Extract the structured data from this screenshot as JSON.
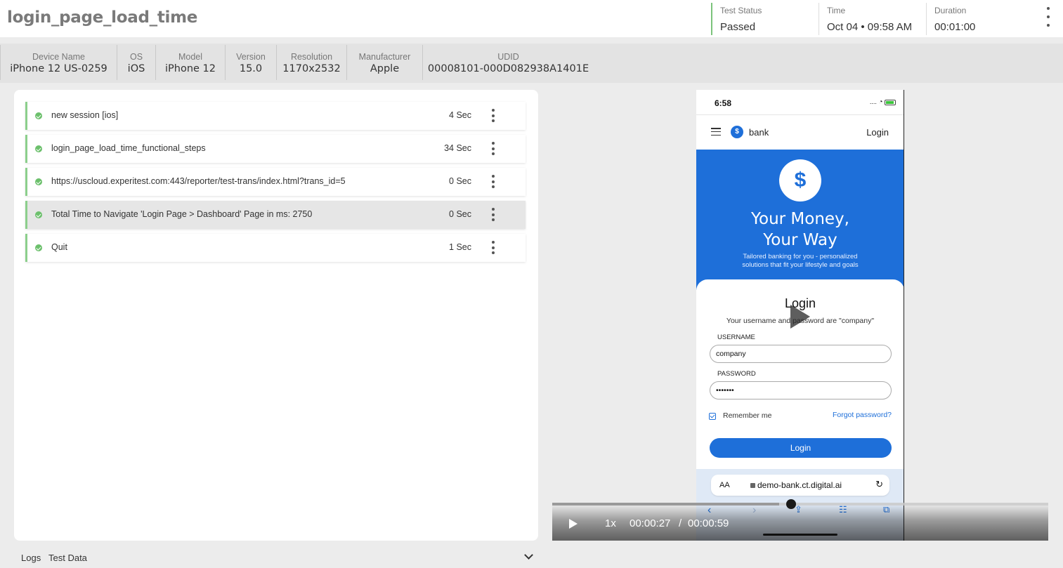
{
  "header": {
    "title": "login_page_load_time",
    "status_label": "Test Status",
    "status_value": "Passed",
    "time_label": "Time",
    "time_value": "Oct 04 • 09:58 AM",
    "duration_label": "Duration",
    "duration_value": "00:01:00"
  },
  "device": {
    "columns": [
      {
        "label": "Device Name",
        "value": "iPhone 12 US-0259"
      },
      {
        "label": "OS",
        "value": "iOS"
      },
      {
        "label": "Model",
        "value": "iPhone 12"
      },
      {
        "label": "Version",
        "value": "15.0"
      },
      {
        "label": "Resolution",
        "value": "1170x2532"
      },
      {
        "label": "Manufacturer",
        "value": "Apple"
      },
      {
        "label": "UDID",
        "value": "00008101-000D082938A1401E"
      }
    ]
  },
  "steps": [
    {
      "name": "new session [ios]",
      "duration": "4 Sec",
      "status": "passed"
    },
    {
      "name": "login_page_load_time_functional_steps",
      "duration": "34 Sec",
      "status": "passed"
    },
    {
      "name": "https://uscloud.experitest.com:443/reporter/test-trans/index.html?trans_id=5",
      "duration": "0 Sec",
      "status": "passed"
    },
    {
      "name": "Total Time to Navigate 'Login Page > Dashboard' Page in ms: 2750",
      "duration": "0 Sec",
      "status": "passed",
      "selected": true
    },
    {
      "name": "Quit",
      "duration": "1 Sec",
      "status": "passed"
    }
  ],
  "phone": {
    "clock": "6:58",
    "signal": "....",
    "app_name": "bank",
    "app_login": "Login",
    "logo_glyph": "$",
    "hero_title_1": "Your Money,",
    "hero_title_2": "Your Way",
    "hero_sub": "Tailored banking for you - personalized solutions that fit your lifestyle and goals",
    "login_title": "Login",
    "login_hint": "Your username and password are \"company\"",
    "username_label": "USERNAME",
    "username_value": "company",
    "password_label": "PASSWORD",
    "password_value": "•••••••",
    "remember_label": "Remember me",
    "forgot_label": "Forgot password?",
    "login_button": "Login",
    "aa": "AA",
    "url": "demo-bank.ct.digital.ai"
  },
  "player": {
    "speed": "1x",
    "current_time": "00:00:27",
    "separator": "/",
    "total_time": "00:00:59",
    "progress": 0.4576
  },
  "footer": {
    "tab_logs": "Logs",
    "tab_test_data": "Test Data"
  },
  "colors": {
    "passed": "#6cc06c",
    "brand_blue": "#1e6fd9"
  }
}
